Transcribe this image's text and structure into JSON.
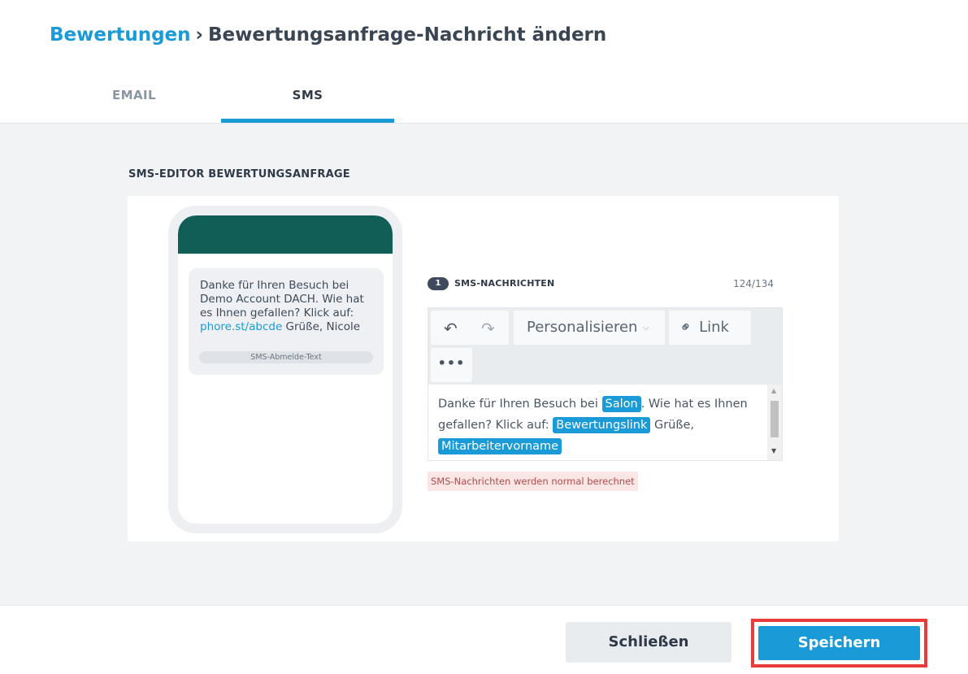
{
  "breadcrumb": {
    "parent": "Bewertungen",
    "separator": "›",
    "current": "Bewertungsanfrage-Nachricht ändern"
  },
  "tabs": [
    {
      "label": "EMAIL",
      "active": false
    },
    {
      "label": "SMS",
      "active": true
    }
  ],
  "section_title": "SMS-EDITOR BEWERTUNGSANFRAGE",
  "preview": {
    "message_text": "Danke für Ihren Besuch bei Demo Account DACH. Wie hat es Ihnen gefallen? Klick auf:",
    "link": "phore.st/abcde",
    "message_end": " Grüße, Nicole",
    "optout_label": "SMS-Abmelde-Text"
  },
  "counter": {
    "count": "1",
    "label": "SMS-NACHRICHTEN",
    "chars": "124/134"
  },
  "toolbar": {
    "undo_icon": "undo-icon",
    "redo_icon": "redo-icon",
    "personalize_label": "Personalisieren",
    "link_label": "Link",
    "more_label": "•••"
  },
  "editor": {
    "text_1": "Danke für Ihren Besuch bei ",
    "tag_salon": "Salon",
    "text_2": ". Wie hat es Ihnen gefallen? Klick auf: ",
    "tag_review_link": "Bewertungslink",
    "text_3": " Grüße, ",
    "tag_employee": "Mitarbeitervorname"
  },
  "notice": "SMS-Nachrichten werden normal berechnet",
  "footer": {
    "close_label": "Schließen",
    "save_label": "Speichern"
  },
  "colors": {
    "accent": "#1a9bd7",
    "phone_header": "#105e55",
    "highlight": "#e83b3b"
  }
}
